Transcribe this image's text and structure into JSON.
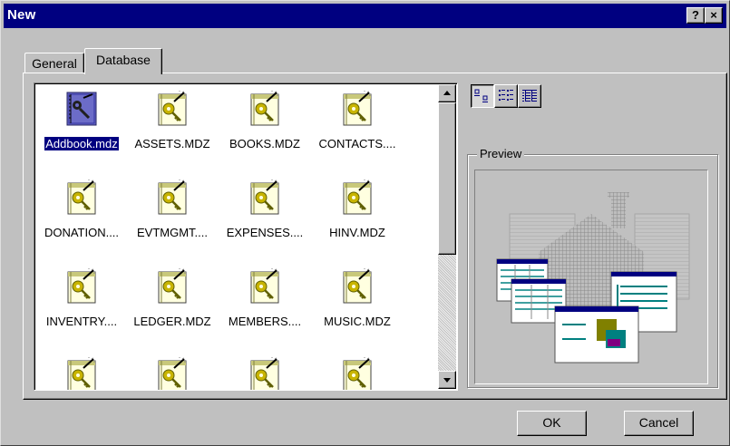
{
  "window": {
    "title": "New",
    "help_label": "?",
    "close_label": "×"
  },
  "tabs": [
    {
      "label": "General",
      "active": false
    },
    {
      "label": "Database",
      "active": true
    }
  ],
  "items": [
    {
      "label": "Addbook.mdz",
      "icon": "database-wizard-icon",
      "selected": true
    },
    {
      "label": "ASSETS.MDZ",
      "icon": "database-template-icon",
      "selected": false
    },
    {
      "label": "BOOKS.MDZ",
      "icon": "database-template-icon",
      "selected": false
    },
    {
      "label": "CONTACTS....",
      "icon": "database-template-icon",
      "selected": false
    },
    {
      "label": "DONATION....",
      "icon": "database-template-icon",
      "selected": false
    },
    {
      "label": "EVTMGMT....",
      "icon": "database-template-icon",
      "selected": false
    },
    {
      "label": "EXPENSES....",
      "icon": "database-template-icon",
      "selected": false
    },
    {
      "label": "HINV.MDZ",
      "icon": "database-template-icon",
      "selected": false
    },
    {
      "label": "INVENTRY....",
      "icon": "database-template-icon",
      "selected": false
    },
    {
      "label": "LEDGER.MDZ",
      "icon": "database-template-icon",
      "selected": false
    },
    {
      "label": "MEMBERS....",
      "icon": "database-template-icon",
      "selected": false
    },
    {
      "label": "MUSIC.MDZ",
      "icon": "database-template-icon",
      "selected": false
    },
    {
      "label": "",
      "icon": "database-template-icon",
      "selected": false
    },
    {
      "label": "",
      "icon": "database-template-icon",
      "selected": false
    },
    {
      "label": "",
      "icon": "database-template-icon",
      "selected": false
    },
    {
      "label": "",
      "icon": "database-template-icon",
      "selected": false
    }
  ],
  "view_buttons": [
    {
      "icon": "large-icons-view-icon",
      "pressed": true
    },
    {
      "icon": "list-view-icon",
      "pressed": false
    },
    {
      "icon": "details-view-icon",
      "pressed": false
    }
  ],
  "preview": {
    "label": "Preview",
    "image": "house-with-forms-illustration"
  },
  "buttons": {
    "ok": "OK",
    "cancel": "Cancel"
  },
  "colors": {
    "titlebar": "#000080",
    "face": "#c0c0c0",
    "selection": "#000080"
  }
}
